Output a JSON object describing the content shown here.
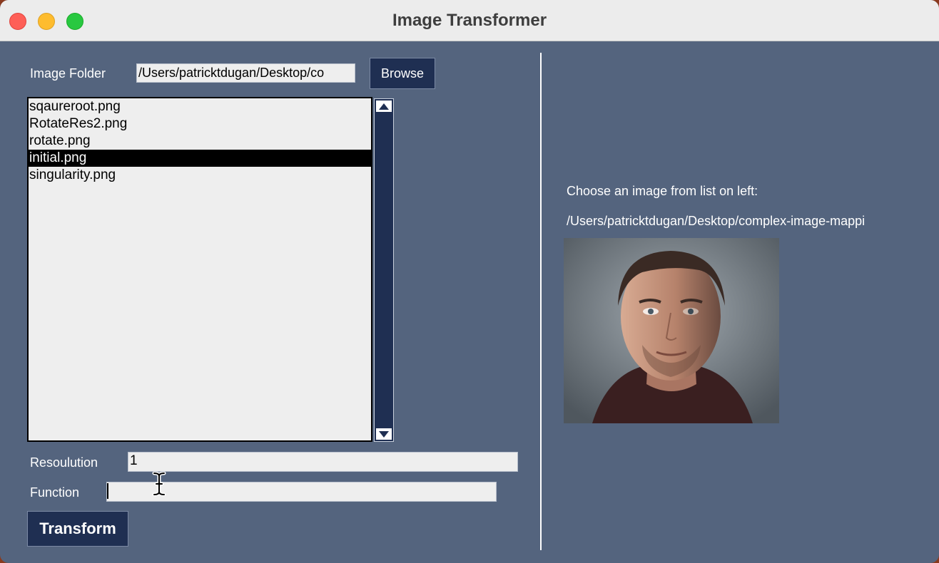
{
  "window": {
    "title": "Image Transformer"
  },
  "left": {
    "folder_label": "Image Folder",
    "folder_value": "/Users/patricktdugan/Desktop/co",
    "browse_label": "Browse",
    "files": [
      "sqaureroot.png",
      "RotateRes2.png",
      "rotate.png",
      "initial.png",
      "singularity.png"
    ],
    "selected_index": 3,
    "resolution_label": "Resoulution",
    "resolution_value": "1",
    "function_label": "Function",
    "function_value": "",
    "transform_label": "Transform"
  },
  "right": {
    "prompt": "Choose an image from list on left:",
    "path": "/Users/patricktdugan/Desktop/complex-image-mappi"
  },
  "icons": {
    "scroll_up": "triangle-up-icon",
    "scroll_down": "triangle-down-icon",
    "cursor": "text-cursor-icon"
  },
  "colors": {
    "window_bg": "#54647e",
    "button_bg": "#1f2f52",
    "selection_bg": "#000000"
  }
}
